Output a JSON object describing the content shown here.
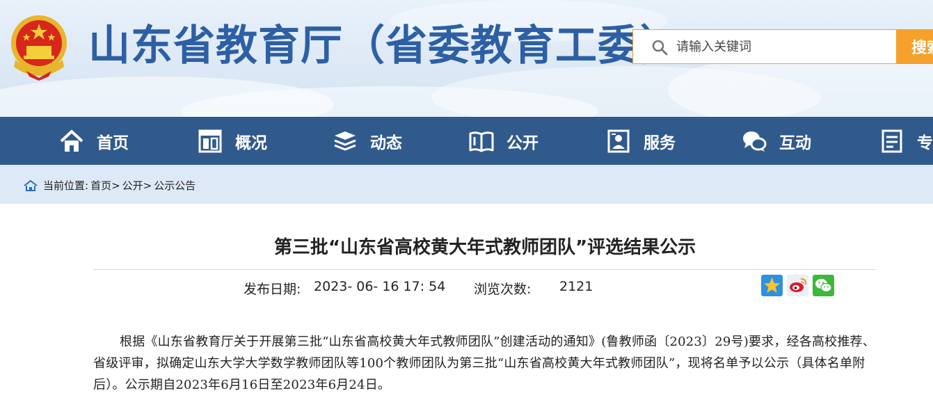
{
  "header": {
    "site_title": "山东省教育厅（省委教育工委）",
    "search": {
      "placeholder": "请输入关键词",
      "button_label": "搜索"
    }
  },
  "nav": {
    "items": [
      {
        "label": "首页",
        "icon": "home-icon"
      },
      {
        "label": "概况",
        "icon": "overview-icon"
      },
      {
        "label": "动态",
        "icon": "news-icon"
      },
      {
        "label": "公开",
        "icon": "book-icon"
      },
      {
        "label": "服务",
        "icon": "service-icon"
      },
      {
        "label": "互动",
        "icon": "chat-icon"
      },
      {
        "label": "专题",
        "icon": "document-icon"
      }
    ]
  },
  "breadcrumb": {
    "prefix": "当前位置:",
    "items": [
      "首页>",
      "公开>",
      "公示公告"
    ]
  },
  "article": {
    "title": "第三批“山东省高校黄大年式教师团队”评选结果公示",
    "publish_label": "发布日期:",
    "publish_date": "2023- 06- 16 17: 54",
    "views_label": "浏览次数:",
    "views": "2121",
    "share": [
      "qzone-icon",
      "weibo-icon",
      "wechat-icon"
    ],
    "body": "根据《山东省教育厅关于开展第三批“山东省高校黄大年式教师团队”创建活动的通知》(鲁教师函〔2023〕29号)要求，经各高校推荐、省级评审，拟确定山东大学大学数学教师团队等100个教师团队为第三批“山东省高校黄大年式教师团队”，现将名单予以公示（具体名单附后）。公示期自2023年6月16日至2023年6月24日。"
  },
  "colors": {
    "title_blue": "#2d5fa4",
    "nav_bg": "#315a8c",
    "search_accent": "#f6a12b",
    "crumb_bg": "#dde9f6"
  }
}
